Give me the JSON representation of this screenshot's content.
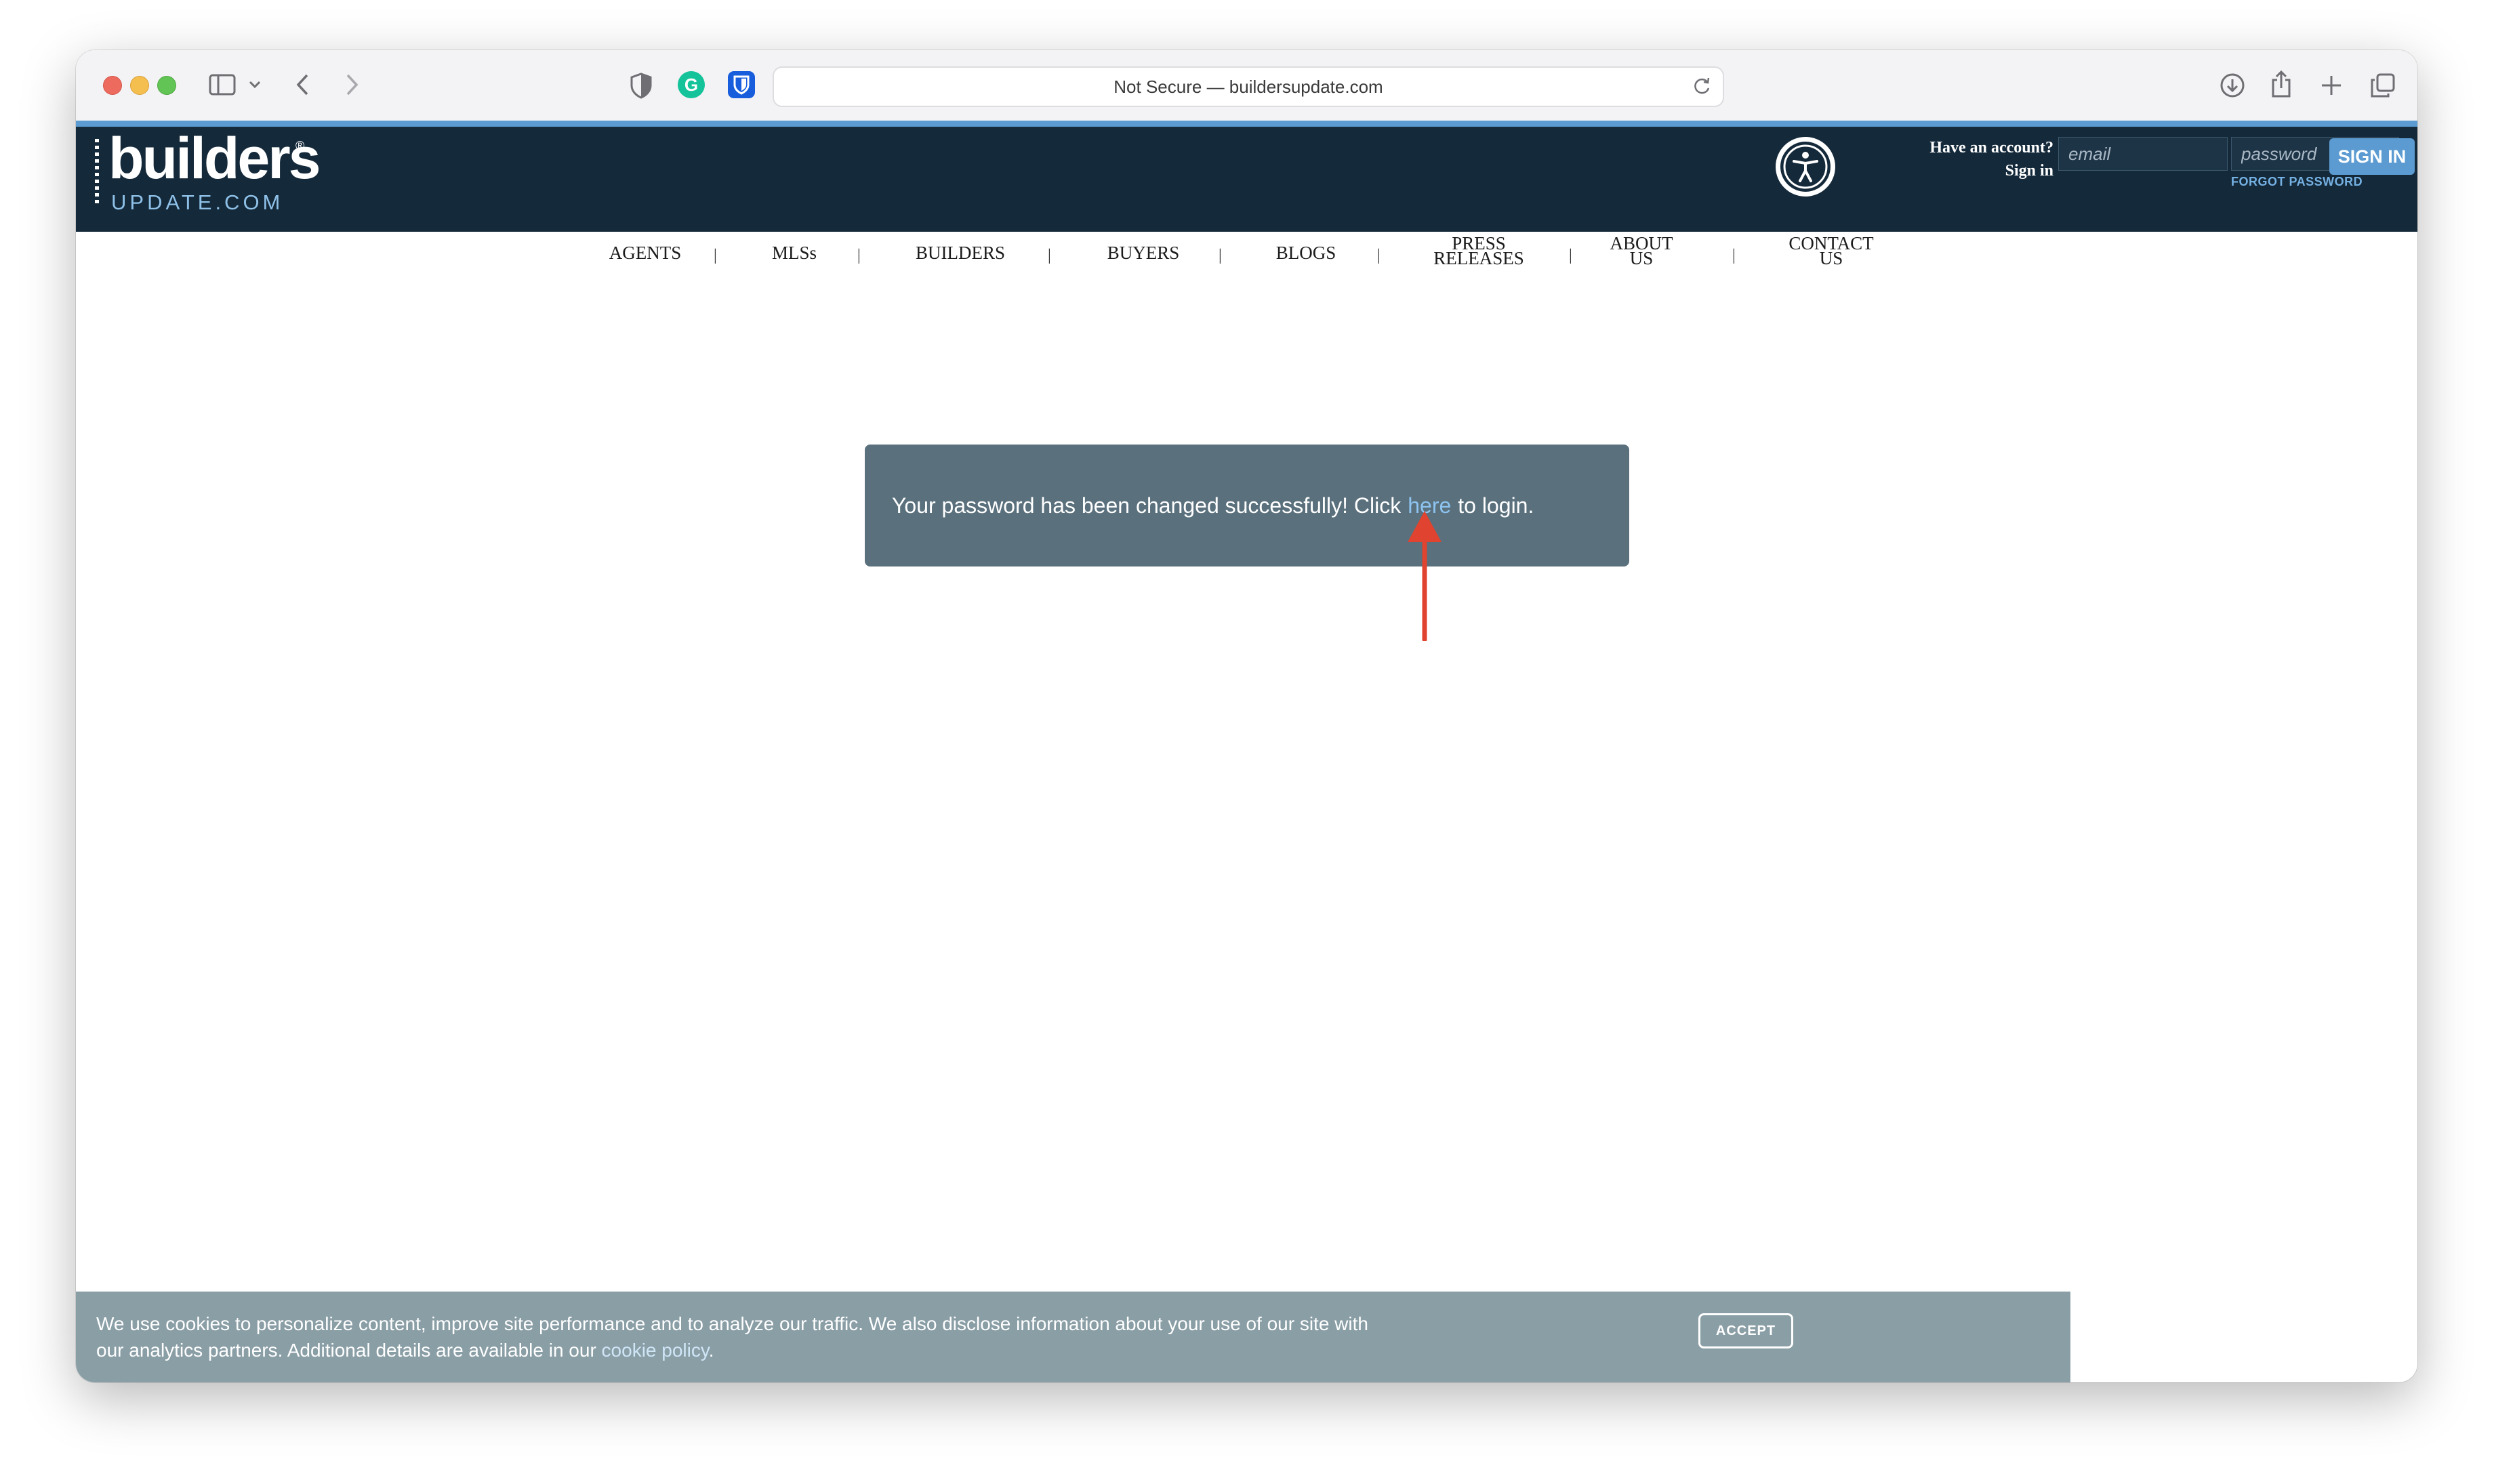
{
  "browser": {
    "url_text": "Not Secure — buildersupdate.com",
    "grammarly_letter": "G"
  },
  "header": {
    "logo": {
      "top": "builders",
      "bottom": "UPDATE.COM",
      "reg": "®"
    },
    "account_question": "Have an account?",
    "signin_label": "Sign in",
    "email_placeholder": "email",
    "password_placeholder": "password",
    "forgot_password": "FORGOT PASSWORD",
    "signin_button": "SIGN IN"
  },
  "nav": {
    "items": [
      {
        "label": "AGENTS"
      },
      {
        "label": "MLSs"
      },
      {
        "label": "BUILDERS"
      },
      {
        "label": "BUYERS"
      },
      {
        "label": "BLOGS"
      },
      {
        "line1": "PRESS",
        "line2": "RELEASES"
      },
      {
        "line1": "ABOUT",
        "line2": "US"
      },
      {
        "line1": "CONTACT",
        "line2": "US"
      }
    ],
    "separator": "|"
  },
  "message": {
    "before": "Your password has been changed successfully! Click",
    "link": "here",
    "after": "to login."
  },
  "cookie_banner": {
    "text_line1": "We use cookies to personalize content, improve site performance and to analyze our traffic. We also disclose information about your use of our site with",
    "text_line2_before": "our analytics partners. Additional details are available in our",
    "link": "cookie policy",
    "text_line2_after": ".",
    "accept": "ACCEPT"
  },
  "colors": {
    "header_bg": "#14293a",
    "accent_blue": "#5b9bd1",
    "message_bg": "#5a707d",
    "cookie_bg": "#8a9ea6",
    "annotation_arrow": "#e0432f"
  }
}
